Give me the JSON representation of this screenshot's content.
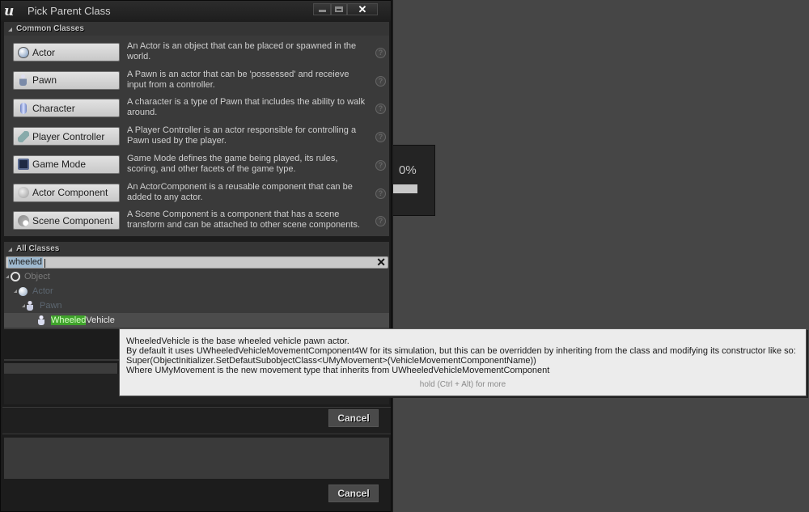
{
  "window": {
    "title": "Pick Parent Class",
    "minimize_label": "minimize",
    "maximize_label": "maximize",
    "close_label": "✕"
  },
  "common_classes": {
    "header": "Common Classes",
    "items": [
      {
        "label": "Actor",
        "icon": "actor-sphere-icon",
        "description": "An Actor is an object that can be placed or spawned in the world."
      },
      {
        "label": "Pawn",
        "icon": "pawn-icon",
        "description": "A Pawn is an actor that can be 'possessed' and receieve input from a controller."
      },
      {
        "label": "Character",
        "icon": "character-capsule-icon",
        "description": "A character is a type of Pawn that includes the ability to walk around."
      },
      {
        "label": "Player Controller",
        "icon": "player-controller-icon",
        "description": "A Player Controller is an actor responsible for controlling a Pawn used by the player."
      },
      {
        "label": "Game Mode",
        "icon": "game-mode-icon",
        "description": "Game Mode defines the game being played, its rules, scoring, and other facets of the game type."
      },
      {
        "label": "Actor Component",
        "icon": "actor-component-icon",
        "description": "An ActorComponent is a reusable component that can be added to any actor."
      },
      {
        "label": "Scene Component",
        "icon": "scene-component-icon",
        "description": "A Scene Component is a component that has a scene transform and can be attached to other scene components."
      }
    ],
    "help_glyph": "?"
  },
  "all_classes": {
    "header": "All Classes",
    "search_value": "wheeled",
    "clear_glyph": "✕",
    "tree": [
      {
        "label": "Object",
        "depth": 0,
        "match": ""
      },
      {
        "label": "Actor",
        "depth": 1,
        "match": ""
      },
      {
        "label": "Pawn",
        "depth": 2,
        "match": ""
      },
      {
        "label_match": "Wheeled",
        "label_rest": "Vehicle",
        "depth": 3,
        "selected": true
      }
    ]
  },
  "tooltip": {
    "lines": [
      "WheeledVehicle is the base wheeled vehicle pawn actor.",
      "By default it uses UWheeledVehicleMovementComponent4W for its simulation, but this can be overridden by inheriting from the class and modifying its constructor like so:",
      "Super(ObjectInitializer.SetDefautSubobjectClass<UMyMovement>(VehicleMovementComponentName))",
      "Where UMyMovement is the new movement type that inherits from UWheeledVehicleMovementComponent"
    ],
    "more_hint": "hold (Ctrl + Alt) for more"
  },
  "buttons": {
    "cancel_label": "Cancel"
  },
  "progress": {
    "label": "0%",
    "value_percent": 0
  }
}
